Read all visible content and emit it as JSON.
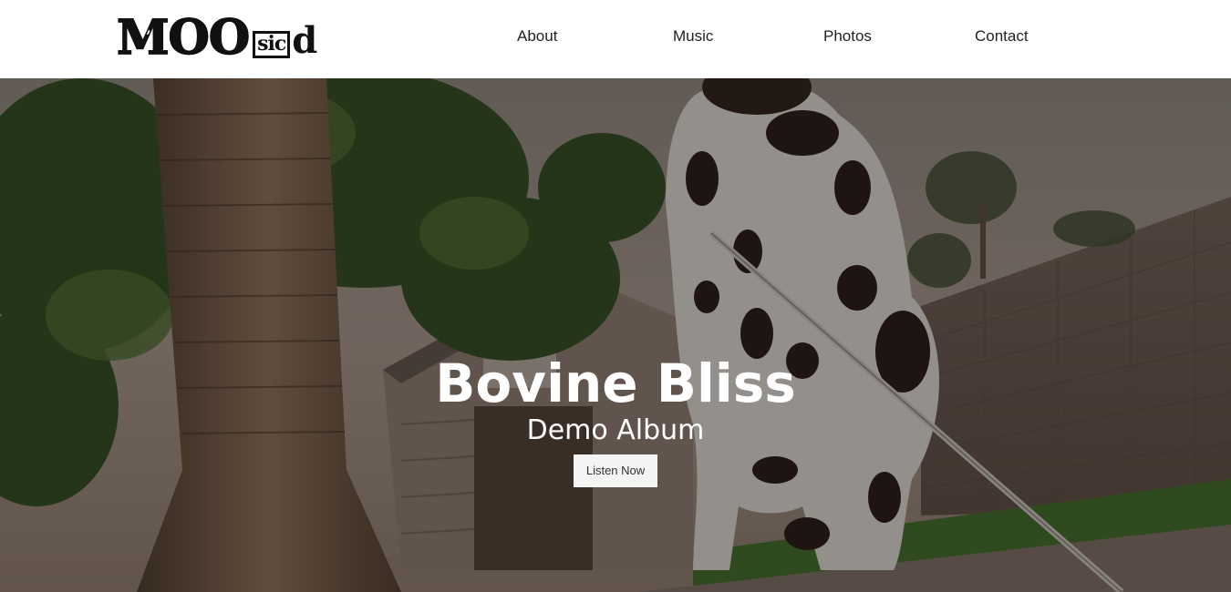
{
  "header": {
    "logo": {
      "main": "MOO",
      "small": "sic",
      "tail": "d",
      "alt": "MOOsicd"
    },
    "nav": [
      {
        "label": "About"
      },
      {
        "label": "Music"
      },
      {
        "label": "Photos"
      },
      {
        "label": "Contact"
      }
    ]
  },
  "hero": {
    "title": "Bovine Bliss",
    "subtitle": "Demo Album",
    "cta_label": "Listen Now"
  },
  "colors": {
    "header_bg": "#ffffff",
    "nav_text": "#222222",
    "hero_text": "#ffffff",
    "button_bg": "#f4f4f2"
  }
}
